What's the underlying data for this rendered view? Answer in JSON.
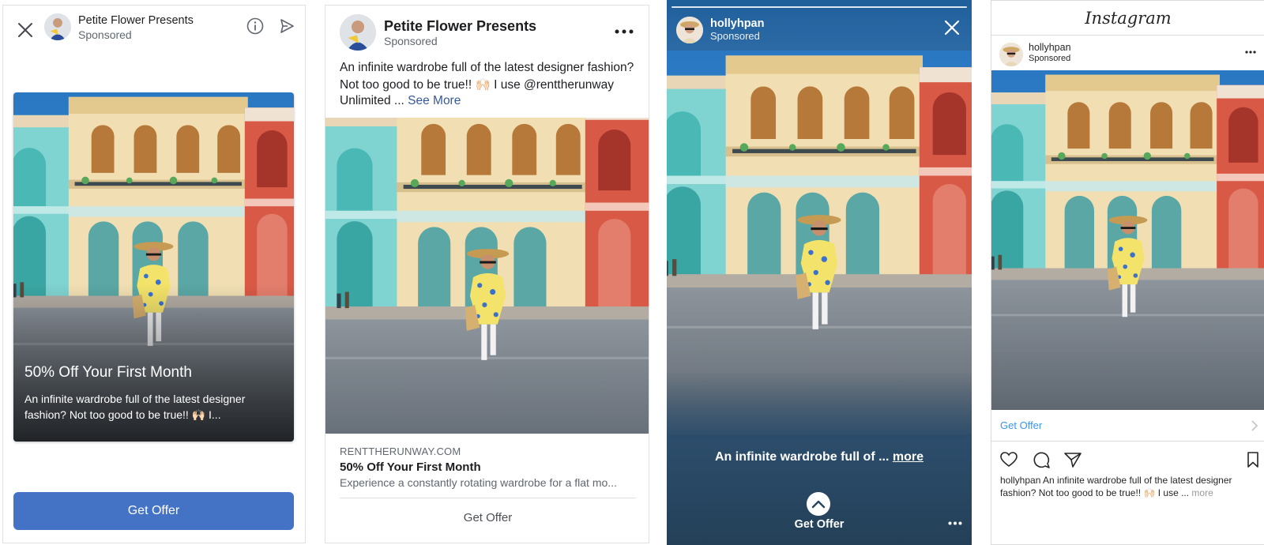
{
  "ads": [
    {
      "brand": "Petite Flower Presents",
      "sponsored": "Sponsored",
      "headline": "50% Off Your First Month",
      "body_line1": "An infinite wardrobe full of the latest designer",
      "body_line2": "fashion? Not too good to be true!! 🙌🏻 I...",
      "cta": "Get Offer"
    },
    {
      "brand": "Petite Flower Presents",
      "sponsored": "Sponsored",
      "copy_line1": "An infinite wardrobe full of the latest designer fashion?",
      "copy_line2": "Not too good to be true!! 🙌🏻  I use @renttherunway",
      "copy_line3": "Unlimited ... ",
      "see_more": "See More",
      "domain": "RENTTHERUNWAY.COM",
      "card_title": "50% Off Your First Month",
      "card_description": "Experience a constantly rotating wardrobe for a flat mo...",
      "cta": "Get Offer"
    },
    {
      "user": "hollyhpan",
      "sponsored": "Sponsored",
      "caption": "An infinite wardrobe full of ... ",
      "more": "more",
      "cta": "Get Offer"
    },
    {
      "logo": "Instagram",
      "user": "hollyhpan",
      "sponsored": "Sponsored",
      "cta": "Get Offer",
      "caption_user": "hollyhpan",
      "caption_line1": " An infinite wardrobe full of the latest designer",
      "caption_line2": "fashion? Not too good to be true!! 🙌🏻  I use ... ",
      "more": "more"
    }
  ],
  "icons": [
    "close-icon",
    "info-icon",
    "send-icon",
    "more-icon",
    "swipe-up-icon",
    "chevron-right-icon",
    "heart-icon",
    "comment-icon",
    "share-icon",
    "bookmark-icon"
  ],
  "colors": {
    "facebook_cta": "#4472c4",
    "link_blue": "#385898",
    "instagram_link": "#3897f0",
    "story_background": "#28445f"
  }
}
